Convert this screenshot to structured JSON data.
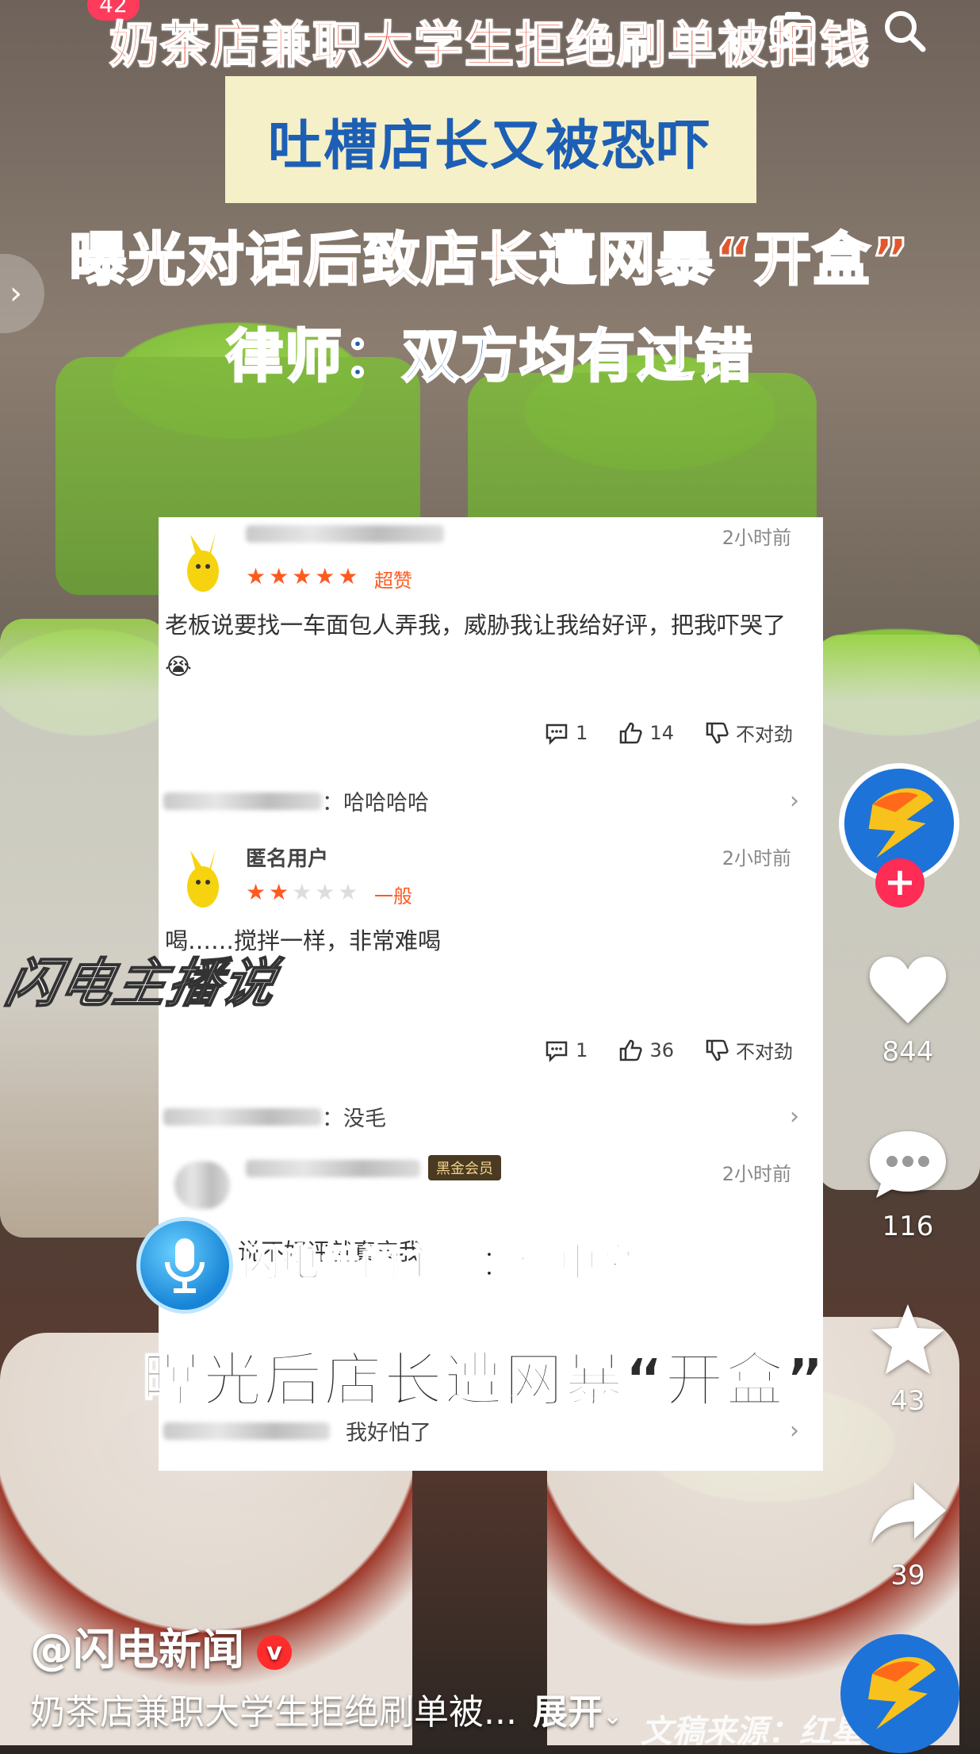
{
  "status": {
    "notification_count": "42"
  },
  "headlines": {
    "line1": "奶茶店兼职大学生拒绝刷单被扣钱",
    "line2": "吐槽店长又被恐吓",
    "line3": "曝光对话后致店长遭网暴“开盒”",
    "line4": "律师：双方均有过错"
  },
  "card": {
    "reviews": [
      {
        "time": "2小时前",
        "rating_label": "超赞",
        "stars": 5,
        "text": "老板说要找一车面包人弄我，威胁我让我给好评，把我吓哭了😭",
        "reply_count": "1",
        "like_count": "14",
        "dislike_label": "不对劲",
        "reply_preview": "：哈哈哈哈"
      },
      {
        "username": "匿名用户",
        "time": "2小时前",
        "rating_label": "一般",
        "stars": 2,
        "text": "喝……搅拌一样，非常难喝",
        "reply_count": "1",
        "like_count": "36",
        "dislike_label": "不对劲",
        "reply_preview": "：没毛"
      },
      {
        "time": "2小时前",
        "vip_label": "黑金会员",
        "text": "说不好评就真实我",
        "reply_preview": "我好怕了"
      }
    ]
  },
  "overlays": {
    "anchor_label": "闪电新闻主播：信中豪",
    "caption": "曝光后店长遭网暴“开盒”",
    "watermark": "闪电主播说"
  },
  "sidebar": {
    "likes": "844",
    "comments": "116",
    "favorites": "43",
    "shares": "39"
  },
  "bottom": {
    "author": "@闪电新闻",
    "description": "奶茶店兼职大学生拒绝刷单被...",
    "expand_label": "展开",
    "source": "文稿来源：红星新闻"
  },
  "colors": {
    "accent_red": "#ff2c55",
    "brand_blue": "#1d5fb5",
    "orange_title": "#e3572f"
  }
}
